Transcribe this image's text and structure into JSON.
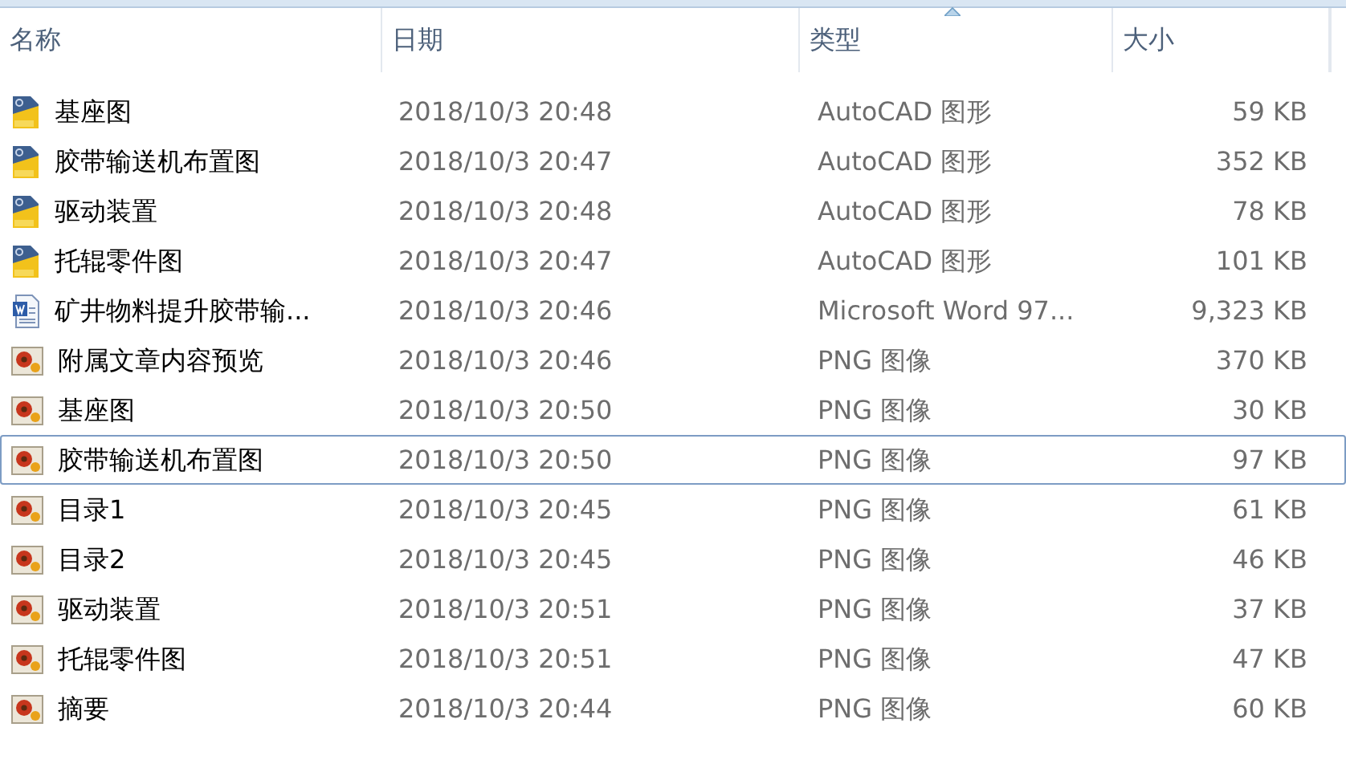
{
  "columns": [
    {
      "label": "名称",
      "sorted": false
    },
    {
      "label": "日期",
      "sorted": false
    },
    {
      "label": "类型",
      "sorted": true
    },
    {
      "label": "大小",
      "sorted": false
    }
  ],
  "rows": [
    {
      "kind": "dwg",
      "name": "基座图",
      "date": "2018/10/3 20:48",
      "type": "AutoCAD 图形",
      "size": "59 KB",
      "focused": false
    },
    {
      "kind": "dwg",
      "name": "胶带输送机布置图",
      "date": "2018/10/3 20:47",
      "type": "AutoCAD 图形",
      "size": "352 KB",
      "focused": false
    },
    {
      "kind": "dwg",
      "name": "驱动装置",
      "date": "2018/10/3 20:48",
      "type": "AutoCAD 图形",
      "size": "78 KB",
      "focused": false
    },
    {
      "kind": "dwg",
      "name": "托辊零件图",
      "date": "2018/10/3 20:47",
      "type": "AutoCAD 图形",
      "size": "101 KB",
      "focused": false
    },
    {
      "kind": "doc",
      "name": "矿井物料提升胶带输...",
      "date": "2018/10/3 20:46",
      "type": "Microsoft Word 97...",
      "size": "9,323 KB",
      "focused": false
    },
    {
      "kind": "png",
      "name": "附属文章内容预览",
      "date": "2018/10/3 20:46",
      "type": "PNG 图像",
      "size": "370 KB",
      "focused": false
    },
    {
      "kind": "png",
      "name": "基座图",
      "date": "2018/10/3 20:50",
      "type": "PNG 图像",
      "size": "30 KB",
      "focused": false
    },
    {
      "kind": "png",
      "name": "胶带输送机布置图",
      "date": "2018/10/3 20:50",
      "type": "PNG 图像",
      "size": "97 KB",
      "focused": true
    },
    {
      "kind": "png",
      "name": "目录1",
      "date": "2018/10/3 20:45",
      "type": "PNG 图像",
      "size": "61 KB",
      "focused": false
    },
    {
      "kind": "png",
      "name": "目录2",
      "date": "2018/10/3 20:45",
      "type": "PNG 图像",
      "size": "46 KB",
      "focused": false
    },
    {
      "kind": "png",
      "name": "驱动装置",
      "date": "2018/10/3 20:51",
      "type": "PNG 图像",
      "size": "37 KB",
      "focused": false
    },
    {
      "kind": "png",
      "name": "托辊零件图",
      "date": "2018/10/3 20:51",
      "type": "PNG 图像",
      "size": "47 KB",
      "focused": false
    },
    {
      "kind": "png",
      "name": "摘要",
      "date": "2018/10/3 20:44",
      "type": "PNG 图像",
      "size": "60 KB",
      "focused": false
    }
  ]
}
